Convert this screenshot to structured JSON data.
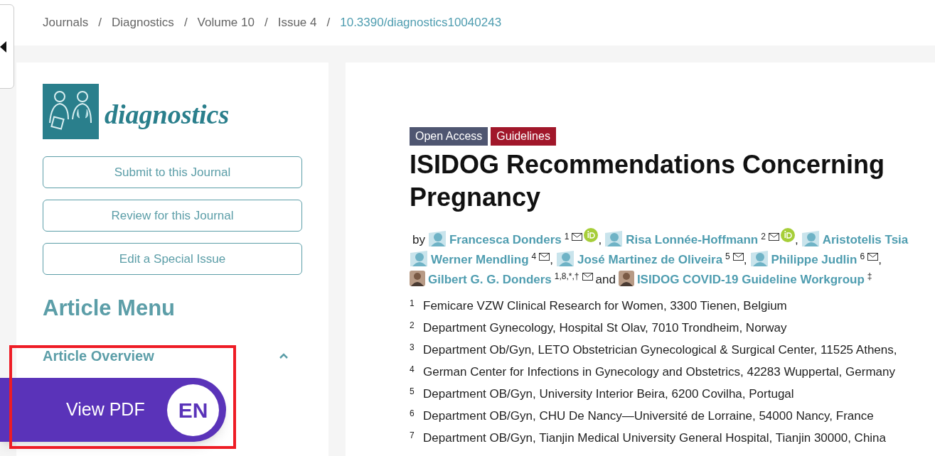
{
  "breadcrumb": [
    {
      "label": "Journals",
      "kind": "crumb"
    },
    {
      "label": "Diagnostics",
      "kind": "crumb"
    },
    {
      "label": "Volume 10",
      "kind": "crumb"
    },
    {
      "label": "Issue 4",
      "kind": "crumb"
    },
    {
      "label": "10.3390/diagnostics10040243",
      "kind": "link"
    }
  ],
  "breadcrumb_separator": "/",
  "sidebar": {
    "journal_name": "diagnostics",
    "buttons": [
      "Submit to this Journal",
      "Review for this Journal",
      "Edit a Special Issue"
    ],
    "menu_title": "Article Menu",
    "section": {
      "label": "Article Overview",
      "expanded": true
    }
  },
  "pdf_button": {
    "label": "View PDF",
    "language": "EN"
  },
  "article": {
    "badges": [
      {
        "label": "Open Access",
        "color": "#4f5671"
      },
      {
        "label": "Guidelines",
        "color": "#a1172a"
      }
    ],
    "title_lines": [
      "ISIDOG Recommendations Concerning",
      "Pregnancy"
    ],
    "author_lines": [
      [
        {
          "before": "by",
          "name": "Francesca Donders",
          "sup": "1",
          "email": true,
          "orcid": true,
          "kind": "placeholder",
          "after": ","
        },
        {
          "name": "Risa Lonnée-Hoffmann",
          "sup": "2",
          "email": true,
          "orcid": true,
          "kind": "placeholder",
          "after": ","
        },
        {
          "name": "Aristotelis Tsia",
          "email": false,
          "orcid": false,
          "kind": "placeholder"
        }
      ],
      [
        {
          "name": "Werner Mendling",
          "sup": "4",
          "email": true,
          "orcid": false,
          "kind": "placeholder",
          "after": ","
        },
        {
          "name": "José Martinez de Oliveira",
          "sup": "5",
          "email": true,
          "orcid": false,
          "kind": "placeholder",
          "after": ","
        },
        {
          "name": "Philippe Judlin",
          "sup": "6",
          "email": true,
          "orcid": false,
          "kind": "placeholder",
          "after": ","
        }
      ],
      [
        {
          "name": "Gilbert G. G. Donders",
          "sup": "1,8,*,†",
          "email": true,
          "orcid": false,
          "kind": "photo"
        },
        {
          "before": "and",
          "name": "ISIDOG COVID-19 Guideline Workgroup",
          "sup": "‡",
          "email": false,
          "orcid": false,
          "kind": "photo"
        }
      ]
    ],
    "affiliations": [
      {
        "number": "1",
        "text": "Femicare VZW Clinical Research for Women, 3300 Tienen, Belgium"
      },
      {
        "number": "2",
        "text": "Department Gynecology, Hospital St Olav, 7010 Trondheim, Norway"
      },
      {
        "number": "3",
        "text": "Department Ob/Gyn, LETO Obstetrician Gynecological & Surgical Center, 11525 Athens,"
      },
      {
        "number": "4",
        "text": "German Center for Infections in Gynecology and Obstetrics, 42283 Wuppertal, Germany"
      },
      {
        "number": "5",
        "text": "Department OB/Gyn, University Interior Beira, 6200 Covilha, Portugal"
      },
      {
        "number": "6",
        "text": "Department OB/Gyn, CHU De Nancy—Université de Lorraine, 54000 Nancy, France"
      },
      {
        "number": "7",
        "text": "Department OB/Gyn, Tianjin Medical University General Hospital, Tianjin 30000, China"
      }
    ]
  }
}
